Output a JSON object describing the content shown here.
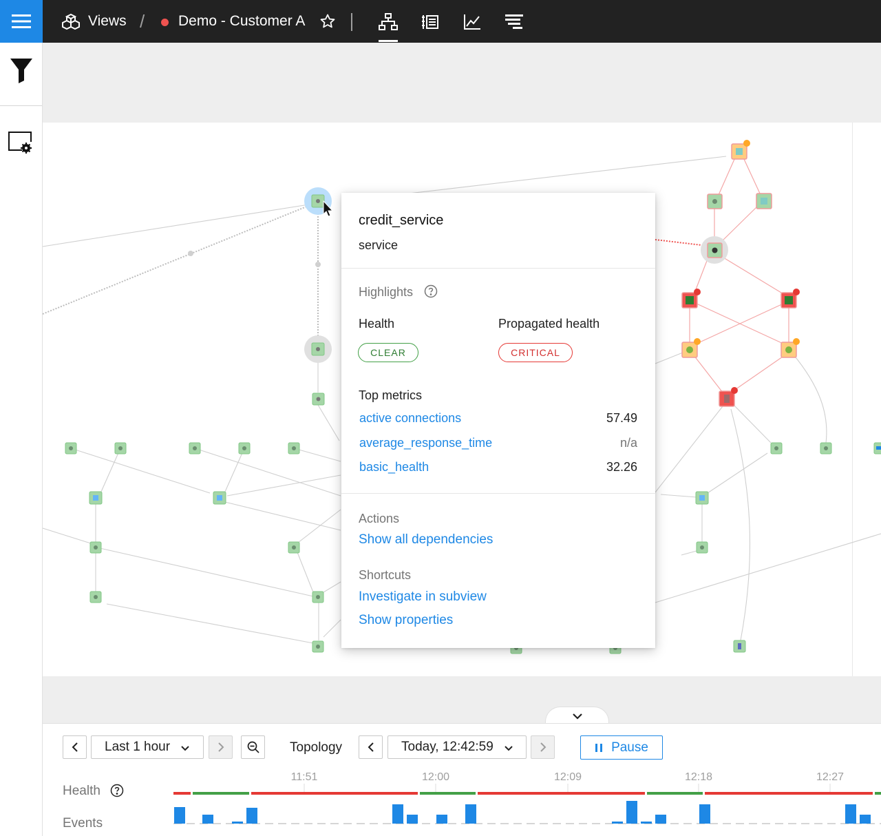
{
  "header": {
    "views_label": "Views",
    "crumb_separator": "/",
    "view_name": "Demo - Customer A",
    "view_status_color": "#ef5350",
    "icons": [
      "menu-icon",
      "views-cubes-icon",
      "star-icon",
      "topology-tab-icon",
      "events-list-tab-icon",
      "metrics-chart-tab-icon",
      "traces-tab-icon"
    ],
    "active_tab": "topology"
  },
  "sidebar": {
    "icons": [
      "filter-icon",
      "view-settings-icon"
    ]
  },
  "popup": {
    "title": "credit_service",
    "type": "service",
    "highlights_label": "Highlights",
    "health_label": "Health",
    "health_value": "CLEAR",
    "propagated_label": "Propagated health",
    "propagated_value": "CRITICAL",
    "top_metrics_label": "Top metrics",
    "metrics": [
      {
        "name": "active connections",
        "value": "57.49"
      },
      {
        "name": "average_response_time",
        "value": "n/a"
      },
      {
        "name": "basic_health",
        "value": "32.26"
      }
    ],
    "actions_label": "Actions",
    "show_all_dependencies": "Show all dependencies",
    "shortcuts_label": "Shortcuts",
    "investigate": "Investigate in subview",
    "show_properties": "Show properties"
  },
  "timeline": {
    "range": "Last 1 hour",
    "topology_label": "Topology",
    "topology_time": "Today, 12:42:59",
    "pause_label": "Pause",
    "health_label": "Health",
    "events_label": "Events",
    "ticks": [
      "11:51",
      "12:00",
      "12:09",
      "12:18",
      "12:27"
    ]
  },
  "colors": {
    "clear": "#43a047",
    "critical": "#e53935",
    "deviating": "#ffa726",
    "accent": "#1e88e5",
    "node_green": "#a5d6a7",
    "node_red": "#ef9a9a",
    "node_orange": "#ffcc80"
  }
}
